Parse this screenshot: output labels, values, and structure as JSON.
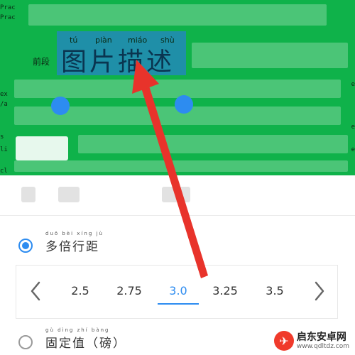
{
  "document": {
    "edge_left": [
      "Prac",
      "Prac",
      "ex",
      "/a",
      "s",
      "li",
      "cl"
    ],
    "edge_right": [
      "e",
      "e",
      "e"
    ],
    "prefix": "前段",
    "selection": {
      "pinyin": [
        "tú",
        "piàn",
        "miáo",
        "shù"
      ],
      "text": "图片描述"
    }
  },
  "spacing": {
    "multiple": {
      "pinyin": "duō bèi xíng jù",
      "label": "多倍行距",
      "selected": true
    },
    "options": [
      "2.5",
      "2.75",
      "3.0",
      "3.25",
      "3.5"
    ],
    "selected_value": "3.0",
    "fixed": {
      "pinyin": "gù dìng zhí bàng",
      "label": "固定值（磅）",
      "selected": false
    }
  },
  "watermark": {
    "name": "启东安卓网",
    "url": "www.qdltdz.com"
  },
  "colors": {
    "document_background": "#0fb24a",
    "selection": "#1f8fa8",
    "accent": "#2d8cf0",
    "arrow": "#e8332b"
  }
}
